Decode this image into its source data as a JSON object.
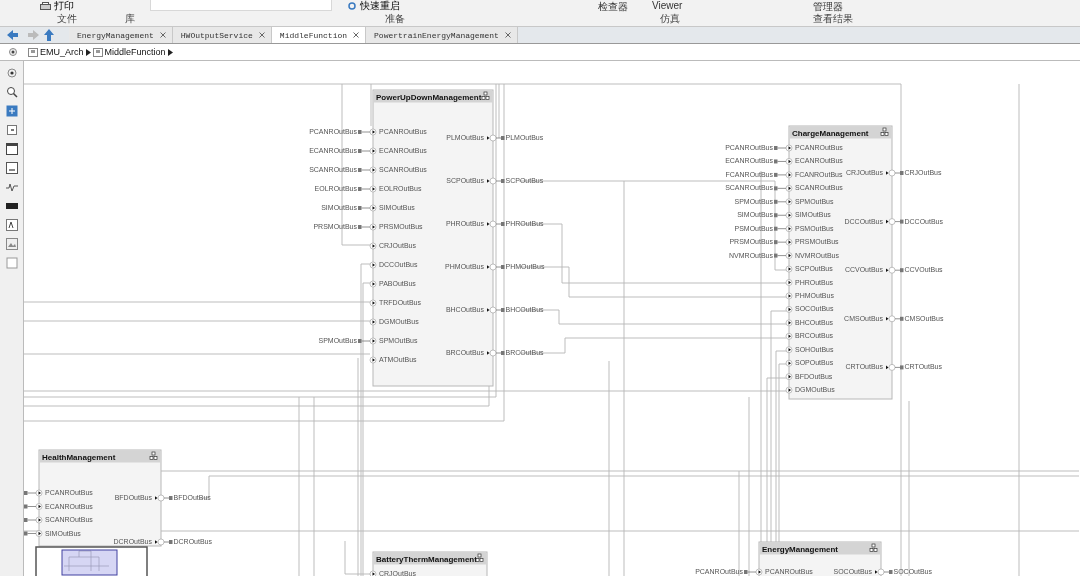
{
  "ribbon": {
    "print_button": "打印",
    "quick_restart_button": "快速重启",
    "inspector_label": "检查器",
    "viewer_label": "Viewer",
    "manager_label": "管理器",
    "sections": [
      "文件",
      "库",
      "准备",
      "仿真",
      "查看结果"
    ]
  },
  "tabs": [
    {
      "label": "EnergyManagement",
      "selected": false
    },
    {
      "label": "HWOutputService",
      "selected": false
    },
    {
      "label": "MiddleFunction",
      "selected": true
    },
    {
      "label": "PowertrainEnergyManagement",
      "selected": false
    }
  ],
  "breadcrumb": [
    "EMU_Arch",
    "MiddleFunction"
  ],
  "blocks": [
    {
      "title": "PowerUpDownManagement",
      "inputs": [
        {
          "label": "PCANROutBus",
          "source": "PCANROutBus"
        },
        {
          "label": "ECANROutBus",
          "source": "ECANROutBus"
        },
        {
          "label": "SCANROutBus",
          "source": "SCANROutBus"
        },
        {
          "label": "EOLROutBus",
          "source": "EOLROutBus"
        },
        {
          "label": "SIMOutBus",
          "source": "SIMOutBus"
        },
        {
          "label": "PRSMOutBus",
          "source": "PRSMOutBus"
        },
        {
          "label": "CRJOutBus"
        },
        {
          "label": "DCCOutBus"
        },
        {
          "label": "PABOutBus"
        },
        {
          "label": "TRFDOutBus"
        },
        {
          "label": "DGMOutBus"
        },
        {
          "label": "SPMOutBus",
          "source": "SPMOutBus"
        },
        {
          "label": "ATMOutBus"
        }
      ],
      "outputs": [
        {
          "label": "PLMOutBus",
          "target": "PLMOutBus"
        },
        {
          "label": "SCPOutBus",
          "target": "SCPOutBus"
        },
        {
          "label": "PHROutBus",
          "target": "PHROutBus"
        },
        {
          "label": "PHMOutBus",
          "target": "PHMOutBus"
        },
        {
          "label": "BHCOutBus",
          "target": "BHCOutBus"
        },
        {
          "label": "BRCOutBus",
          "target": "BRCOutBus"
        }
      ]
    },
    {
      "title": "ChargeManagement",
      "inputs": [
        {
          "label": "PCANROutBus",
          "source": "PCANROutBus"
        },
        {
          "label": "ECANROutBus",
          "source": "ECANROutBus"
        },
        {
          "label": "FCANROutBus",
          "source": "FCANROutBus"
        },
        {
          "label": "SCANROutBus",
          "source": "SCANROutBus"
        },
        {
          "label": "SPMOutBus",
          "source": "SPMOutBus"
        },
        {
          "label": "SIMOutBus",
          "source": "SIMOutBus"
        },
        {
          "label": "PSMOutBus",
          "source": "PSMOutBus"
        },
        {
          "label": "PRSMOutBus",
          "source": "PRSMOutBus"
        },
        {
          "label": "NVMROutBus",
          "source": "NVMROutBus"
        },
        {
          "label": "SCPOutBus"
        },
        {
          "label": "PHROutBus"
        },
        {
          "label": "PHMOutBus"
        },
        {
          "label": "SOCOutBus"
        },
        {
          "label": "BHCOutBus"
        },
        {
          "label": "BRCOutBus"
        },
        {
          "label": "SOHOutBus"
        },
        {
          "label": "SOPOutBus"
        },
        {
          "label": "BFDOutBus"
        },
        {
          "label": "DGMOutBus"
        }
      ],
      "outputs": [
        {
          "label": "CRJOutBus",
          "target": "CRJOutBus"
        },
        {
          "label": "DCCOutBus",
          "target": "DCCOutBus"
        },
        {
          "label": "CCVOutBus",
          "target": "CCVOutBus"
        },
        {
          "label": "CMSOutBus",
          "target": "CMSOutBus"
        },
        {
          "label": "CRTOutBus",
          "target": "CRTOutBus"
        }
      ]
    },
    {
      "title": "HealthManagement",
      "inputs": [
        {
          "label": "PCANROutBus",
          "source_port": true
        },
        {
          "label": "ECANROutBus",
          "source_port": true
        },
        {
          "label": "SCANROutBus",
          "source_port": true
        },
        {
          "label": "SIMOutBus",
          "source_port": true
        }
      ],
      "outputs": [
        {
          "label": "BFDOutBus",
          "target": "BFDOutBus"
        },
        {
          "label": "DCROutBus",
          "target": "DCROutBus"
        }
      ]
    },
    {
      "title": "BatteryThermManagement",
      "inputs": [
        {
          "label": "CRJOutBus"
        }
      ]
    },
    {
      "title": "EnergyManagement",
      "inputs": [
        {
          "label": "PCANROutBus",
          "source": "PCANROutBus"
        }
      ],
      "outputs": [
        {
          "label": "SOCOutBus",
          "target": "SOCOutBus"
        }
      ]
    }
  ]
}
